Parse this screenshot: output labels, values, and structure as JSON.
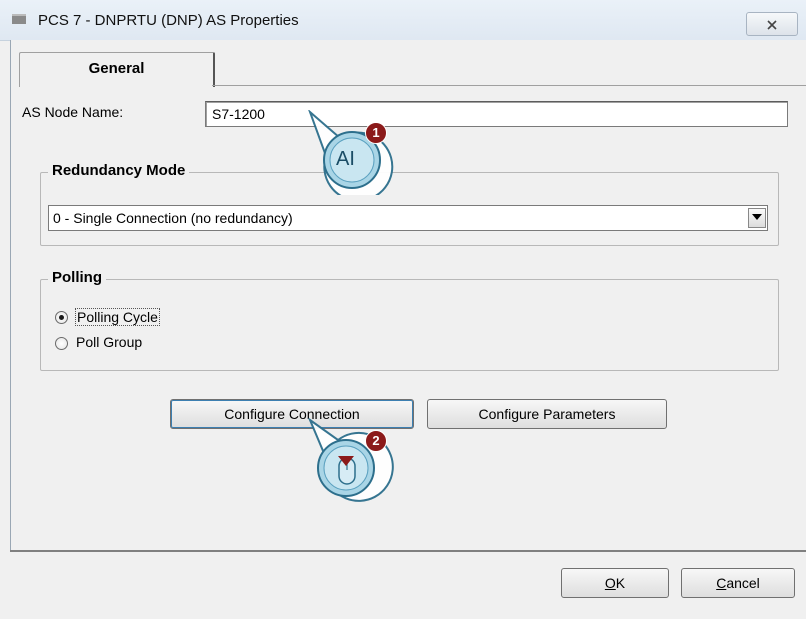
{
  "window": {
    "title": "PCS 7 - DNPRTU (DNP) AS Properties",
    "close_label": "☒"
  },
  "tabs": [
    {
      "label": "General",
      "selected": true
    }
  ],
  "node": {
    "label": "AS Node Name:",
    "value": "S7-1200"
  },
  "redundancy": {
    "group_label": "Redundancy Mode",
    "selected": "0 - Single Connection (no redundancy)"
  },
  "polling": {
    "group_label": "Polling",
    "options": [
      {
        "label": "Polling Cycle",
        "checked": true
      },
      {
        "label": "Poll Group",
        "checked": false
      }
    ]
  },
  "buttons": {
    "configure_connection": "Configure Connection",
    "configure_parameters": "Configure Parameters",
    "ok": "OK",
    "cancel": "Cancel"
  },
  "callouts": [
    {
      "number": "1",
      "icon": "text-cursor-icon",
      "text": "AI"
    },
    {
      "number": "2",
      "icon": "mouse-click-icon"
    }
  ],
  "colors": {
    "callout_accent": "#8b1a1a",
    "callout_bubble": "#a9d5e6"
  }
}
